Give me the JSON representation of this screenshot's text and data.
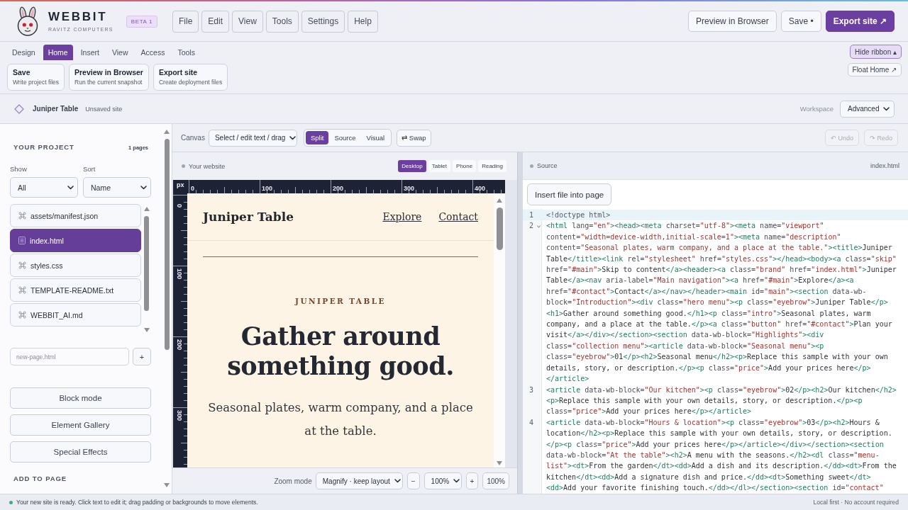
{
  "app": {
    "name": "WEBBIT",
    "vendor": "RAVITZ COMPUTERS",
    "badge": "BETA 1"
  },
  "menu": [
    "File",
    "Edit",
    "View",
    "Tools",
    "Settings",
    "Help"
  ],
  "header_actions": [
    {
      "label": "Preview in Browser",
      "kind": "secondary"
    },
    {
      "label": "Save •",
      "kind": "secondary"
    },
    {
      "label": "Export site ↗",
      "kind": "primary"
    }
  ],
  "ribbon": {
    "tabs": [
      {
        "label": "Design",
        "selected": false
      },
      {
        "label": "Home",
        "selected": true
      },
      {
        "label": "Insert",
        "selected": false
      },
      {
        "label": "View",
        "selected": false
      },
      {
        "label": "Access",
        "selected": false
      },
      {
        "label": "Tools",
        "selected": false
      }
    ],
    "commands": [
      {
        "title": "Save",
        "subtitle": "Write project files"
      },
      {
        "title": "Preview in Browser",
        "subtitle": "Run the current snapshot"
      },
      {
        "title": "Export site",
        "subtitle": "Create deployment files"
      }
    ],
    "options": [
      {
        "label": "Hide ribbon ▴",
        "active": true
      },
      {
        "label": "Float Home ↗",
        "active": false
      }
    ]
  },
  "project": {
    "name": "Juniper Table",
    "status": "Unsaved site",
    "workspace": {
      "label": "Workspace",
      "value": "Advanced"
    }
  },
  "sidebar": {
    "title": "YOUR PROJECT",
    "count": "1 pages",
    "filters": [
      {
        "label": "Show",
        "value": "All"
      },
      {
        "label": "Sort",
        "value": "Name"
      }
    ],
    "files": [
      {
        "name": "assets/manifest.json",
        "kind": "file",
        "selected": false
      },
      {
        "name": "index.html",
        "kind": "page",
        "selected": true
      },
      {
        "name": "styles.css",
        "kind": "file",
        "selected": false
      },
      {
        "name": "TEMPLATE-README.txt",
        "kind": "file",
        "selected": false
      },
      {
        "name": "WEBBIT_AI.md",
        "kind": "file",
        "selected": false
      }
    ],
    "new_page": {
      "placeholder": "new-page.html",
      "button": "+"
    },
    "tools": [
      "Block mode",
      "Element Gallery",
      "Special Effects"
    ],
    "section": "ADD TO PAGE"
  },
  "canvas_toolbar": {
    "label": "Canvas",
    "mode": "Select / edit text / drag",
    "views": [
      {
        "label": "Split",
        "selected": true
      },
      {
        "label": "Source",
        "selected": false
      },
      {
        "label": "Visual",
        "selected": false
      }
    ],
    "swap": "⇄ Swap",
    "history": [
      {
        "label": "↶ Undo",
        "disabled": true
      },
      {
        "label": "↷ Redo",
        "disabled": true
      }
    ]
  },
  "preview": {
    "title": "Your website",
    "devices": [
      {
        "label": "Desktop",
        "selected": true
      },
      {
        "label": "Tablet",
        "selected": false
      },
      {
        "label": "Phone",
        "selected": false
      },
      {
        "label": "Reading",
        "selected": false
      }
    ],
    "ruler": {
      "unit": "px",
      "x_marks": [
        "0",
        "100",
        "200",
        "300",
        "400"
      ],
      "y_marks": [
        "0",
        "100",
        "200",
        "300"
      ]
    },
    "site": {
      "brand": "Juniper Table",
      "nav": [
        "Explore",
        "Contact"
      ],
      "eyebrow": "JUNIPER TABLE",
      "heading": "Gather around something good.",
      "intro": "Seasonal plates, warm company, and a place at the table."
    },
    "zoom": {
      "label": "Zoom mode",
      "mode": "Magnify · keep layout",
      "minus": "−",
      "value": "100%",
      "plus": "+",
      "reset": "100%"
    }
  },
  "source": {
    "title": "Source",
    "file": "index.html",
    "insert_button": "Insert file into page",
    "lines": [
      {
        "number": "1",
        "active": true,
        "foldable": false,
        "rows": [
          "<!doctype html>"
        ]
      },
      {
        "number": "2",
        "active": false,
        "foldable": true,
        "rows": [
          "<html lang=\"en\"><head><meta charset=\"utf-8\"><meta name=\"viewport\"",
          "content=\"width=device-width,initial-scale=1\"><meta name=\"description\"",
          "content=\"Seasonal plates, warm company, and a place at the table.\"><title>Juniper",
          "Table</title><link rel=\"stylesheet\" href=\"styles.css\"></head><body><a class=\"skip\"",
          "href=\"#main\">Skip to content</a><header><a class=\"brand\" href=\"index.html\">Juniper",
          "Table</a><nav aria-label=\"Main navigation\"><a href=\"#main\">Explore</a><a",
          "href=\"#contact\">Contact</a></nav></header><main id=\"main\"><section data-wb-",
          "block=\"Introduction\"><div class=\"hero menu\"><p class=\"eyebrow\">Juniper Table</p>",
          "<h1>Gather around something good.</h1><p class=\"intro\">Seasonal plates, warm",
          "company, and a place at the table.</p><a class=\"button\" href=\"#contact\">Plan your",
          "visit</a></div></section><section data-wb-block=\"Highlights\"><div",
          "class=\"collection menu\"><article data-wb-block=\"Seasonal menu\"><p",
          "class=\"eyebrow\">01</p><h2>Seasonal menu</h2><p>Replace this sample with your own",
          "details, story, or description.</p><p class=\"price\">Add your prices here</p>",
          "</article>"
        ]
      },
      {
        "number": "3",
        "active": false,
        "foldable": false,
        "rows": [
          "<article data-wb-block=\"Our kitchen\"><p class=\"eyebrow\">02</p><h2>Our kitchen</h2>",
          "<p>Replace this sample with your own details, story, or description.</p><p",
          "class=\"price\">Add your prices here</p></article>"
        ]
      },
      {
        "number": "4",
        "active": false,
        "foldable": false,
        "rows": [
          "<article data-wb-block=\"Hours & location\"><p class=\"eyebrow\">03</p><h2>Hours &",
          "location</h2><p>Replace this sample with your own details, story, or description.",
          "</p><p class=\"price\">Add your prices here</p></article></div></section><section",
          "data-wb-block=\"At the table\"><h2>A menu with the seasons.</h2><dl class=\"menu-",
          "list\"><dt>From the garden</dt><dd>Add a dish and its description.</dd><dt>From the",
          "kitchen</dt><dd>Add a signature dish and price.</dd><dt>Something sweet</dt>",
          "<dd>Add your favorite finishing touch.</dd></dl></section><section id=\"contact\""
        ]
      }
    ]
  },
  "status_bar": {
    "message": "Your new site is ready. Click text to edit it; drag padding or backgrounds to move elements.",
    "note": "Local first · No account required"
  }
}
